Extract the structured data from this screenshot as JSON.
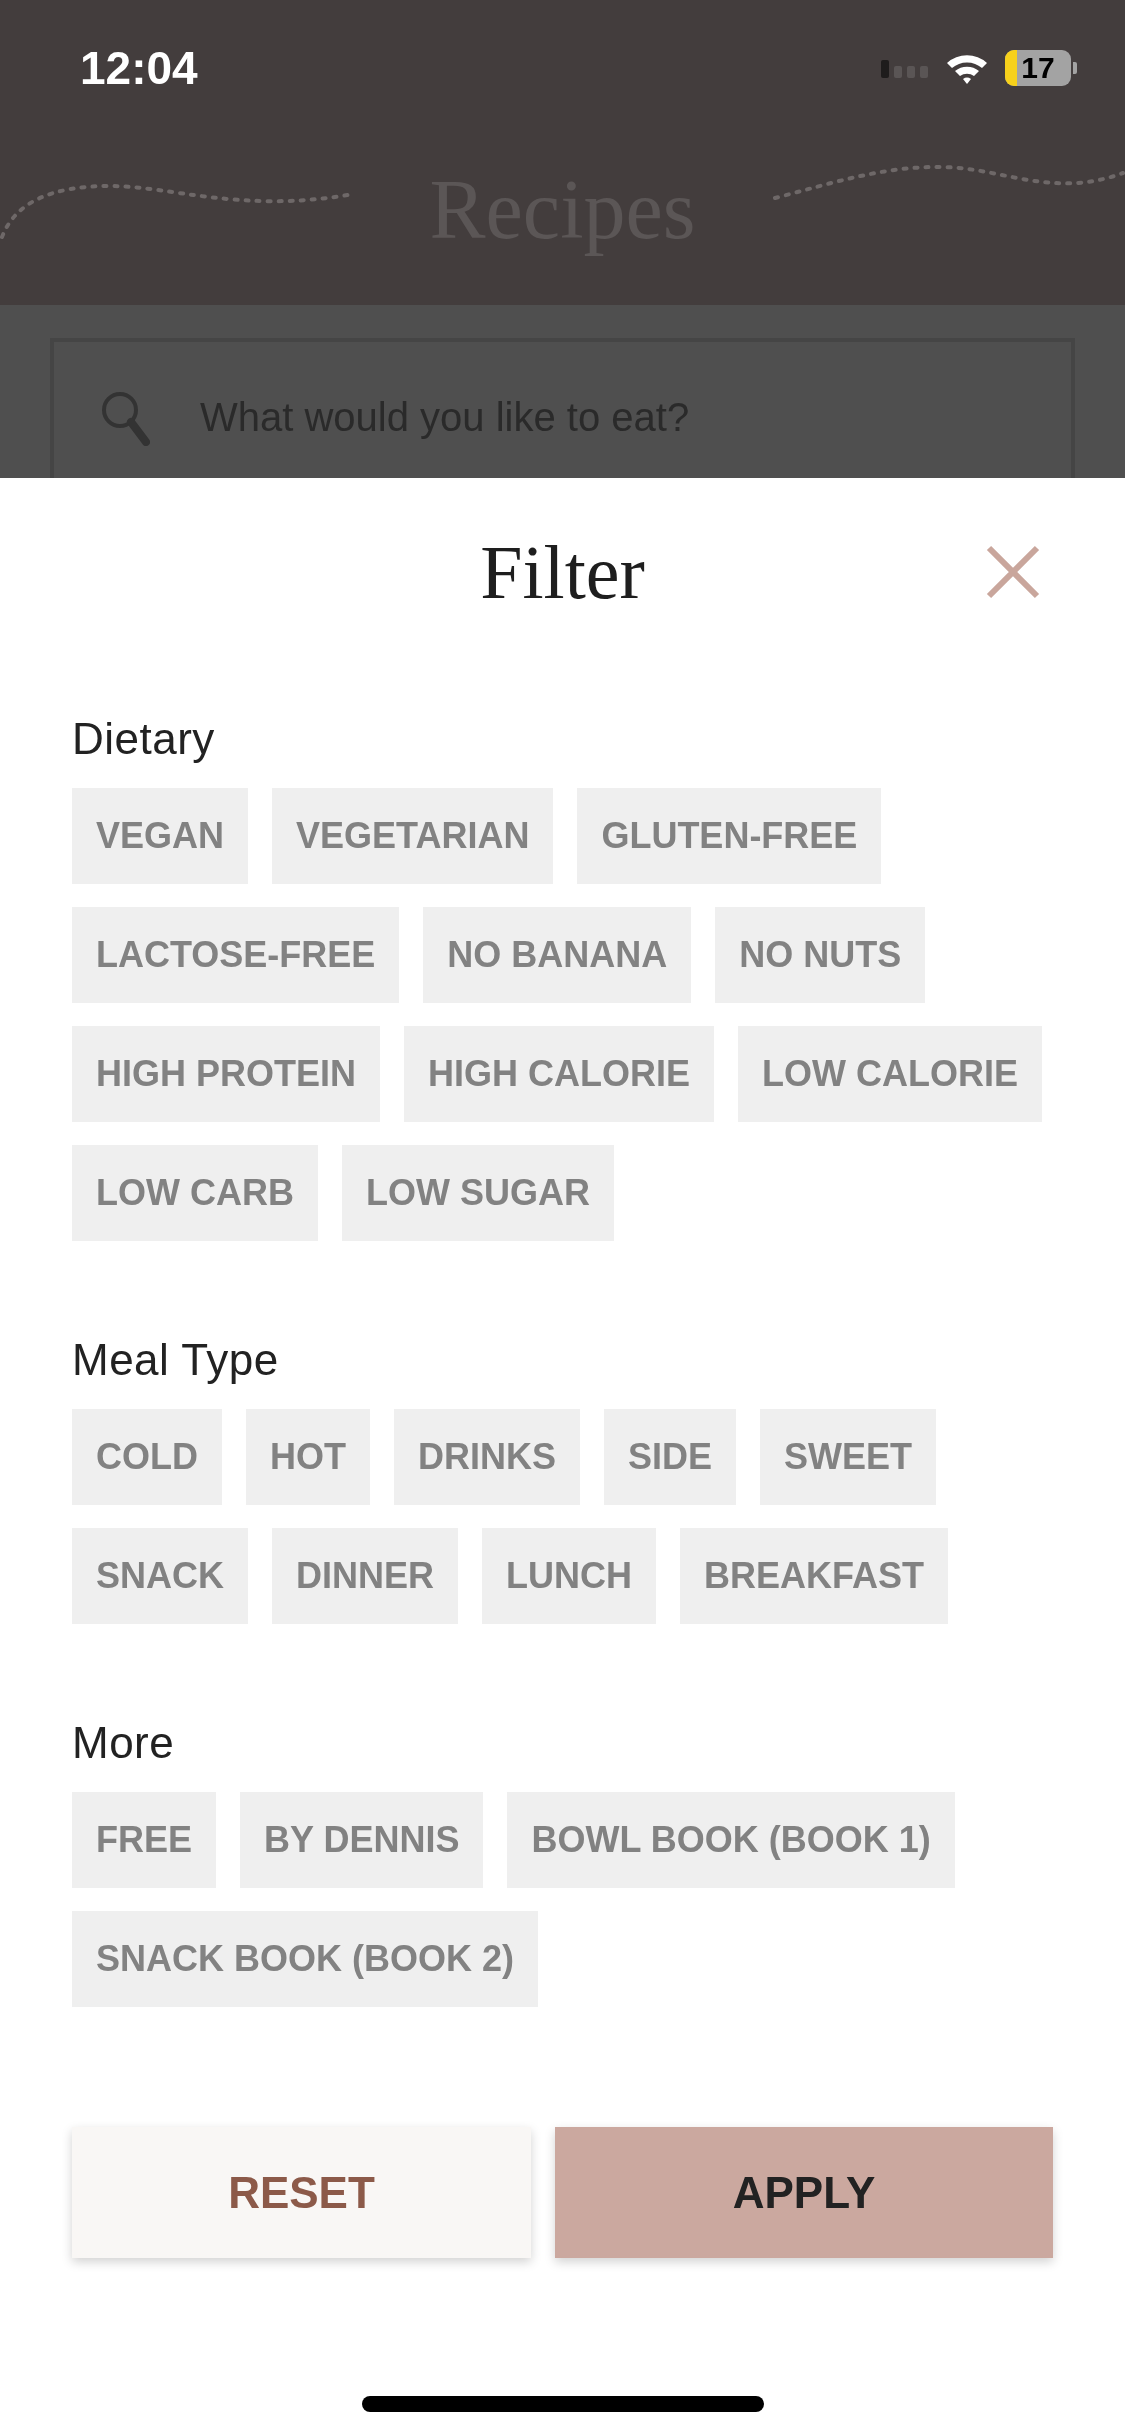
{
  "status_bar": {
    "time": "12:04",
    "battery": "17"
  },
  "header": {
    "title": "Recipes"
  },
  "search": {
    "placeholder": "What would you like to eat?"
  },
  "filter_sheet": {
    "title": "Filter",
    "sections": [
      {
        "label": "Dietary",
        "chips": [
          {
            "label": "VEGAN",
            "selected": false
          },
          {
            "label": "VEGETARIAN",
            "selected": false
          },
          {
            "label": "GLUTEN-FREE",
            "selected": false
          },
          {
            "label": "LACTOSE-FREE",
            "selected": false
          },
          {
            "label": "NO BANANA",
            "selected": false
          },
          {
            "label": "NO NUTS",
            "selected": false
          },
          {
            "label": "HIGH PROTEIN",
            "selected": false
          },
          {
            "label": "HIGH CALORIE",
            "selected": false
          },
          {
            "label": "LOW CALORIE",
            "selected": false
          },
          {
            "label": "LOW CARB",
            "selected": false
          },
          {
            "label": "LOW SUGAR",
            "selected": false
          }
        ]
      },
      {
        "label": "Meal Type",
        "chips": [
          {
            "label": "COLD",
            "selected": false
          },
          {
            "label": "HOT",
            "selected": false
          },
          {
            "label": "DRINKS",
            "selected": false
          },
          {
            "label": "SIDE",
            "selected": false
          },
          {
            "label": "SWEET",
            "selected": false
          },
          {
            "label": "SNACK",
            "selected": false
          },
          {
            "label": "DINNER",
            "selected": false
          },
          {
            "label": "LUNCH",
            "selected": false
          },
          {
            "label": "BREAKFAST",
            "selected": false
          }
        ]
      },
      {
        "label": "More",
        "chips": [
          {
            "label": "FREE",
            "selected": false
          },
          {
            "label": "BY DENNIS",
            "selected": false
          },
          {
            "label": "BOWL BOOK (BOOK 1)",
            "selected": false
          },
          {
            "label": "SNACK BOOK (BOOK 2)",
            "selected": false
          }
        ]
      }
    ],
    "buttons": [
      {
        "label": "RESET",
        "kind": "secondary"
      },
      {
        "label": "APPLY",
        "kind": "primary"
      }
    ]
  }
}
